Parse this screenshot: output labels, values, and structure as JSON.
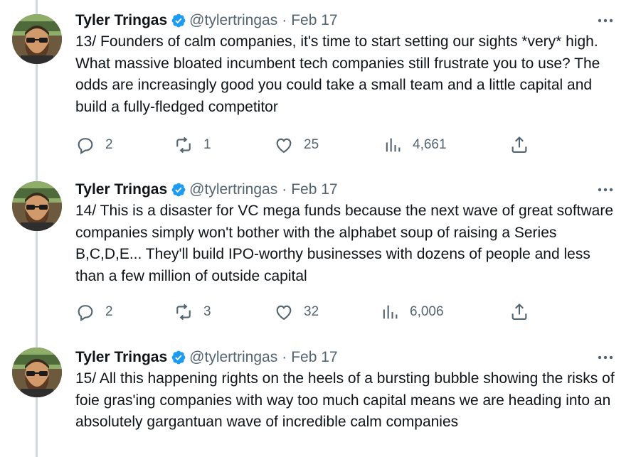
{
  "tweets": [
    {
      "name": "Tyler Tringas",
      "handle": "@tylertringas",
      "separator": "·",
      "date": "Feb 17",
      "text": "13/ Founders of calm companies, it's time to start setting our sights *very* high. What massive bloated incumbent tech companies still frustrate you to use? The odds are increasingly good you could take a small team and a little capital and build a fully-fledged competitor",
      "replies": "2",
      "retweets": "1",
      "likes": "25",
      "views": "4,661"
    },
    {
      "name": "Tyler Tringas",
      "handle": "@tylertringas",
      "separator": "·",
      "date": "Feb 17",
      "text": "14/ This is a disaster for VC mega funds because the next wave of great software companies simply won't bother with the alphabet soup of raising a Series B,C,D,E... They'll build IPO-worthy businesses with dozens of people and less than a few million of outside capital",
      "replies": "2",
      "retweets": "3",
      "likes": "32",
      "views": "6,006"
    },
    {
      "name": "Tyler Tringas",
      "handle": "@tylertringas",
      "separator": "·",
      "date": "Feb 17",
      "text": "15/ All this happening rights on the heels of a bursting bubble showing the risks of foie gras'ing companies with way too much capital means we are heading into an absolutely gargantuan wave of incredible calm companies"
    }
  ],
  "colors": {
    "verified": "#1d9bf0",
    "thread_line": "#cfd9de",
    "secondary_text": "#536471",
    "primary_text": "#0f1419"
  },
  "icons": {
    "verified": "verified-badge-icon",
    "more": "more-dots-icon",
    "reply": "reply-bubble-icon",
    "retweet": "retweet-icon",
    "like": "heart-icon",
    "views": "views-bar-chart-icon",
    "share": "share-upload-icon"
  }
}
